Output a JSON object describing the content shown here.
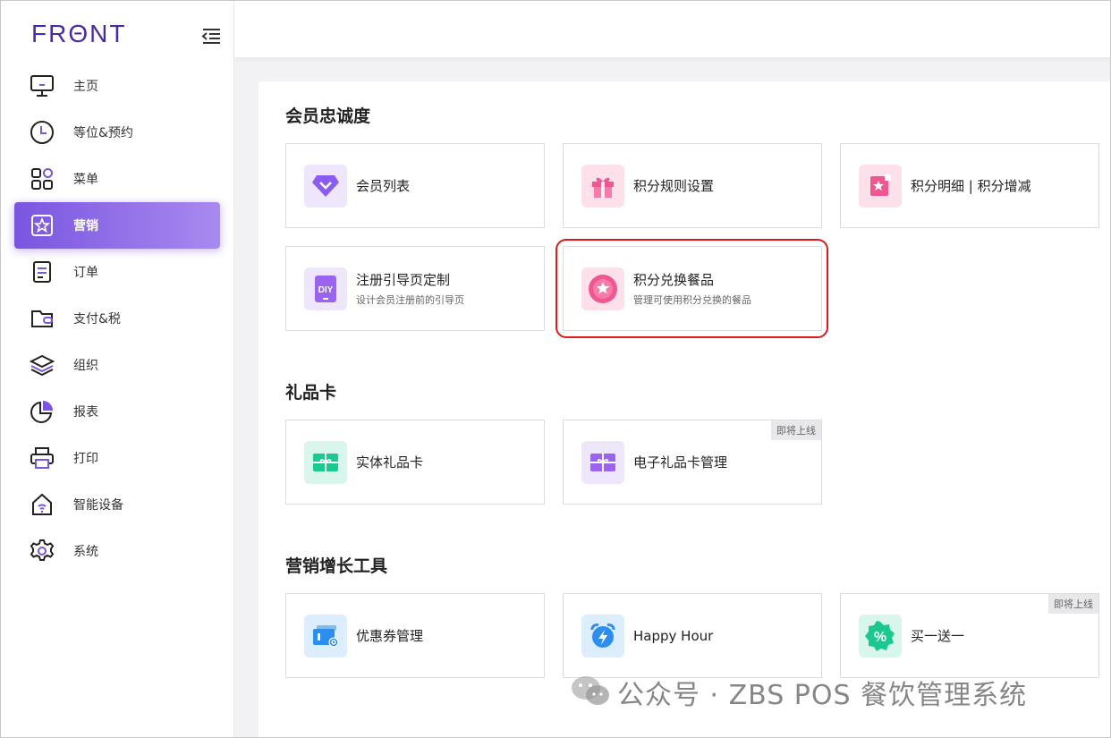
{
  "brand": {
    "logo": "FRΘNT"
  },
  "colors": {
    "accent": "#7a55e0",
    "highlight": "#e01818"
  },
  "sidebar": {
    "items": [
      {
        "label": "主页",
        "icon": "monitor-icon"
      },
      {
        "label": "等位&预约",
        "icon": "clock-icon"
      },
      {
        "label": "菜单",
        "icon": "grid-icon"
      },
      {
        "label": "营销",
        "icon": "star-badge-icon",
        "active": true
      },
      {
        "label": "订单",
        "icon": "document-icon"
      },
      {
        "label": "支付&税",
        "icon": "wallet-icon"
      },
      {
        "label": "组织",
        "icon": "layers-icon"
      },
      {
        "label": "报表",
        "icon": "pie-chart-icon"
      },
      {
        "label": "打印",
        "icon": "printer-icon"
      },
      {
        "label": "智能设备",
        "icon": "smart-device-icon"
      },
      {
        "label": "系统",
        "icon": "gear-icon"
      }
    ]
  },
  "sections": {
    "loyalty": {
      "title": "会员忠诚度",
      "cards": [
        {
          "title": "会员列表",
          "icon": "diamond-icon"
        },
        {
          "title": "积分规则设置",
          "icon": "gift-box-icon"
        },
        {
          "title": "积分明细 | 积分增减",
          "icon": "star-card-icon"
        },
        {
          "title": "注册引导页定制",
          "subtitle": "设计会员注册前的引导页",
          "icon": "diy-tablet-icon"
        },
        {
          "title": "积分兑换餐品",
          "subtitle": "管理可使用积分兑换的餐品",
          "icon": "star-coin-icon"
        }
      ]
    },
    "giftcard": {
      "title": "礼品卡",
      "cards": [
        {
          "title": "实体礼品卡",
          "icon": "gift-card-icon"
        },
        {
          "title": "电子礼品卡管理",
          "icon": "e-gift-card-icon",
          "badge": "即将上线"
        }
      ]
    },
    "growth": {
      "title": "营销增长工具",
      "cards": [
        {
          "title": "优惠券管理",
          "icon": "coupon-icon"
        },
        {
          "title": "Happy Hour",
          "icon": "alarm-clock-icon"
        },
        {
          "title": "买一送一",
          "icon": "percent-badge-icon",
          "badge": "即将上线"
        }
      ]
    }
  },
  "watermark": {
    "text": "公众号 · ZBS POS 餐饮管理系统"
  }
}
